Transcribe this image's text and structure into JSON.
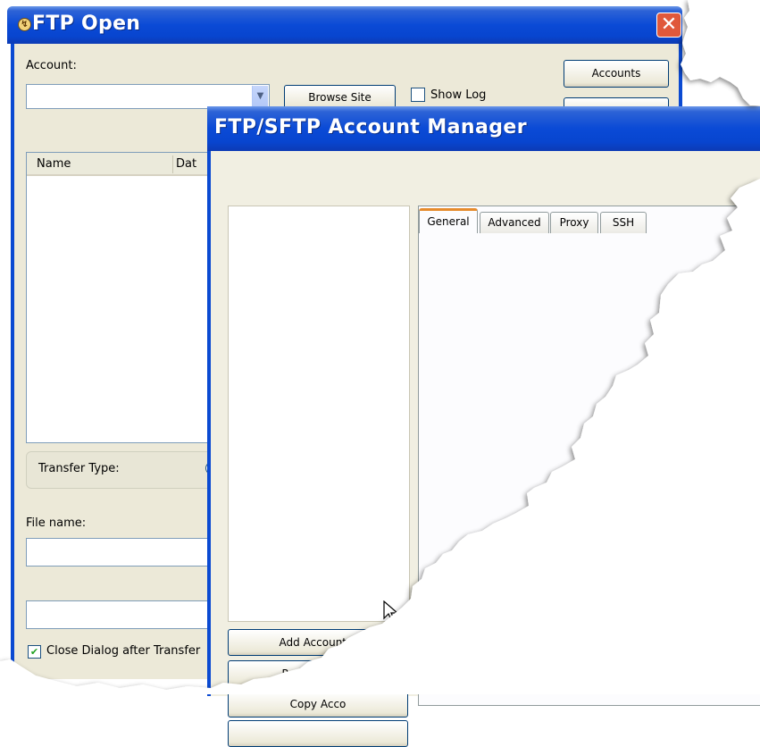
{
  "ftp_open": {
    "title": "FTP Open",
    "account_label": "Account:",
    "account_value": "",
    "browse_site_label": "Browse Site",
    "show_log_label": "Show Log",
    "accounts_label": "Accounts",
    "list_columns": [
      "Name",
      "Dat"
    ],
    "transfer_type_label": "Transfer Type:",
    "file_name_label": "File name:",
    "close_after_label": "Close Dialog after Transfer",
    "close_after_checked": true
  },
  "account_manager": {
    "title": "FTP/SFTP Account Manager",
    "tabs": [
      "General",
      "Advanced",
      "Proxy",
      "SSH"
    ],
    "active_tab": "General",
    "buttons": {
      "add": "Add Account...",
      "remove": "Remove Acco",
      "copy": "Copy Acco"
    }
  },
  "colors": {
    "titlebar_blue": "#0a4ad6",
    "dialog_face": "#ece9d8",
    "active_tab_highlight": "#e68b2c",
    "close_button_red": "#e0583b"
  }
}
